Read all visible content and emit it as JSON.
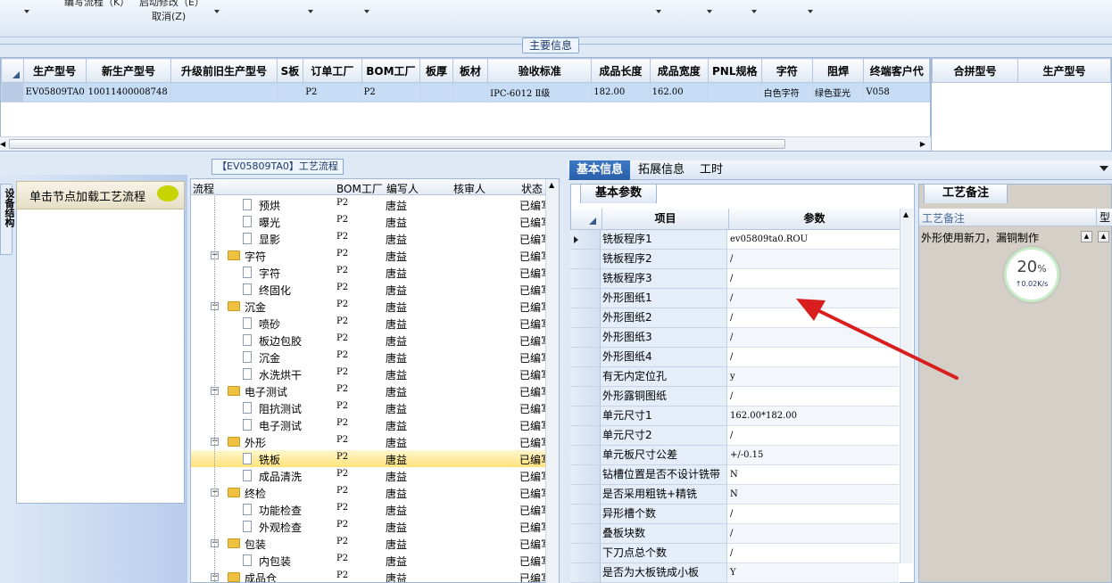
{
  "toolbar": {
    "item1": "编写流程（K）",
    "item2": "启动修改（E）",
    "item3": "取消(Z)"
  },
  "main_section_title": "主要信息",
  "main_grid": {
    "columns": [
      "生产型号",
      "新生产型号",
      "升级前旧生产型号",
      "S板",
      "订单工厂",
      "BOM工厂",
      "板厚",
      "板材",
      "验收标准",
      "成品长度",
      "成品宽度",
      "PNL规格",
      "字符",
      "阻焊",
      "终端客户代"
    ],
    "row": [
      "EV05809TA0",
      "10011400008748",
      "",
      "",
      "P2",
      "P2",
      "",
      "",
      "IPC-6012 Ⅱ级",
      "182.00",
      "162.00",
      "",
      "白色字符",
      "绿色亚光",
      "V058"
    ]
  },
  "right_grid": {
    "columns": [
      "合拼型号",
      "生产型号"
    ]
  },
  "left_panel": {
    "vertical_tab": "设备结构",
    "load_text": "单击节点加载工艺流程"
  },
  "flow_title": "【EV05809TA0】工艺流程",
  "tree": {
    "headers": [
      "流程",
      "BOM工厂",
      "编写人",
      "核审人",
      "状态"
    ],
    "rows": [
      {
        "name": "预烘",
        "level": 2,
        "factory": "P2",
        "writer": "唐益",
        "status": "已编写"
      },
      {
        "name": "曝光",
        "level": 2,
        "factory": "P2",
        "writer": "唐益",
        "status": "已编写"
      },
      {
        "name": "显影",
        "level": 2,
        "factory": "P2",
        "writer": "唐益",
        "status": "已编写"
      },
      {
        "name": "字符",
        "level": 1,
        "factory": "P2",
        "writer": "唐益",
        "status": "已编写"
      },
      {
        "name": "字符",
        "level": 2,
        "factory": "P2",
        "writer": "唐益",
        "status": "已编写"
      },
      {
        "name": "终固化",
        "level": 2,
        "factory": "P2",
        "writer": "唐益",
        "status": "已编写"
      },
      {
        "name": "沉金",
        "level": 1,
        "factory": "P2",
        "writer": "唐益",
        "status": "已编写"
      },
      {
        "name": "喷砂",
        "level": 2,
        "factory": "P2",
        "writer": "唐益",
        "status": "已编写"
      },
      {
        "name": "板边包胶",
        "level": 2,
        "factory": "P2",
        "writer": "唐益",
        "status": "已编写"
      },
      {
        "name": "沉金",
        "level": 2,
        "factory": "P2",
        "writer": "唐益",
        "status": "已编写"
      },
      {
        "name": "水洗烘干",
        "level": 2,
        "factory": "P2",
        "writer": "唐益",
        "status": "已编写"
      },
      {
        "name": "电子测试",
        "level": 1,
        "factory": "P2",
        "writer": "唐益",
        "status": "已编写"
      },
      {
        "name": "阻抗测试",
        "level": 2,
        "factory": "P2",
        "writer": "唐益",
        "status": "已编写"
      },
      {
        "name": "电子测试",
        "level": 2,
        "factory": "P2",
        "writer": "唐益",
        "status": "已编写"
      },
      {
        "name": "外形",
        "level": 1,
        "factory": "P2",
        "writer": "唐益",
        "status": "已编写"
      },
      {
        "name": "铣板",
        "level": 2,
        "factory": "P2",
        "writer": "唐益",
        "status": "已编写",
        "selected": true
      },
      {
        "name": "成品清洗",
        "level": 2,
        "factory": "P2",
        "writer": "唐益",
        "status": "已编写"
      },
      {
        "name": "终检",
        "level": 1,
        "factory": "P2",
        "writer": "唐益",
        "status": "已编写"
      },
      {
        "name": "功能检查",
        "level": 2,
        "factory": "P2",
        "writer": "唐益",
        "status": "已编写"
      },
      {
        "name": "外观检查",
        "level": 2,
        "factory": "P2",
        "writer": "唐益",
        "status": "已编写"
      },
      {
        "name": "包装",
        "level": 1,
        "factory": "P2",
        "writer": "唐益",
        "status": "已编写"
      },
      {
        "name": "内包装",
        "level": 2,
        "factory": "P2",
        "writer": "唐益",
        "status": "已编写"
      },
      {
        "name": "成品仓",
        "level": 1,
        "factory": "P2",
        "writer": "唐益",
        "status": "已编写"
      }
    ]
  },
  "tabs": [
    "基本信息",
    "拓展信息",
    "工时"
  ],
  "basic_panel": {
    "tab": "基本参数",
    "headers": [
      "项目",
      "参数"
    ],
    "rows": [
      {
        "k": "铣板程序1",
        "v": "ev05809ta0.ROU"
      },
      {
        "k": "铣板程序2",
        "v": "/"
      },
      {
        "k": "铣板程序3",
        "v": "/"
      },
      {
        "k": "外形图纸1",
        "v": "/"
      },
      {
        "k": "外形图纸2",
        "v": "/"
      },
      {
        "k": "外形图纸3",
        "v": "/"
      },
      {
        "k": "外形图纸4",
        "v": "/"
      },
      {
        "k": "有无内定位孔",
        "v": "y"
      },
      {
        "k": "外形露铜图纸",
        "v": "/"
      },
      {
        "k": "单元尺寸1",
        "v": "162.00*182.00"
      },
      {
        "k": "单元尺寸2",
        "v": "/"
      },
      {
        "k": "单元板尺寸公差",
        "v": "+/-0.15"
      },
      {
        "k": "钻槽位置是否不设计铣带",
        "v": "N"
      },
      {
        "k": "是否采用粗铣+精铣",
        "v": "N"
      },
      {
        "k": "异形槽个数",
        "v": "/"
      },
      {
        "k": "叠板块数",
        "v": "/"
      },
      {
        "k": "下刀点总个数",
        "v": "/"
      },
      {
        "k": "是否为大板铣成小板",
        "v": "Y"
      }
    ]
  },
  "note_panel": {
    "tab": "工艺备注",
    "header": "工艺备注",
    "header2": "型",
    "text": "外形使用新刀，漏铜制作"
  },
  "network_widget": {
    "percent": "20",
    "percent_unit": "%",
    "speed": "0.02K/s"
  },
  "colors": {
    "arrow": "#d81e1e",
    "accent": "#2a5fa8",
    "highlight": "#ffe27a"
  }
}
